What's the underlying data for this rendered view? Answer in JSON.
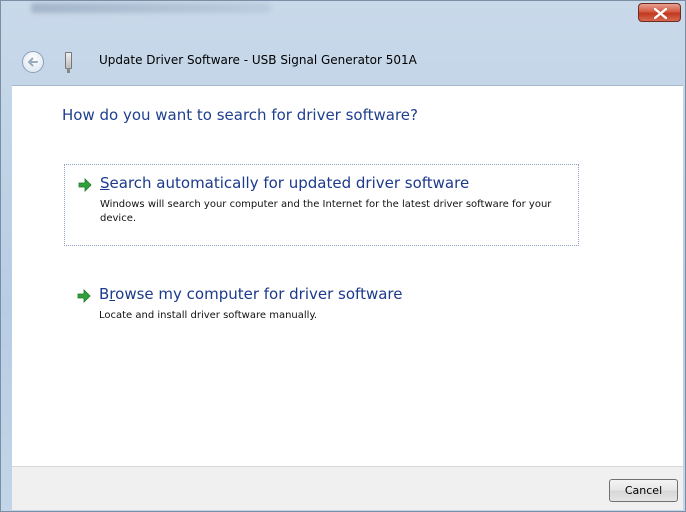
{
  "window": {
    "title": "Update Driver Software - USB Signal Generator 501A"
  },
  "heading": "How do you want to search for driver software?",
  "options": [
    {
      "title_pre": "",
      "title_key": "S",
      "title_post": "earch automatically for updated driver software",
      "description": "Windows will search your computer and the Internet for the latest driver software for your device."
    },
    {
      "title_pre": "B",
      "title_key": "r",
      "title_post": "owse my computer for driver software",
      "description": "Locate and install driver software manually."
    }
  ],
  "footer": {
    "cancel_label": "Cancel"
  },
  "colors": {
    "heading": "#1f3f8f",
    "option_title": "#1c3a8c",
    "arrow": "#2fa23a"
  },
  "icons": [
    "close-icon",
    "back-arrow-icon",
    "usb-device-icon",
    "green-arrow-icon"
  ]
}
